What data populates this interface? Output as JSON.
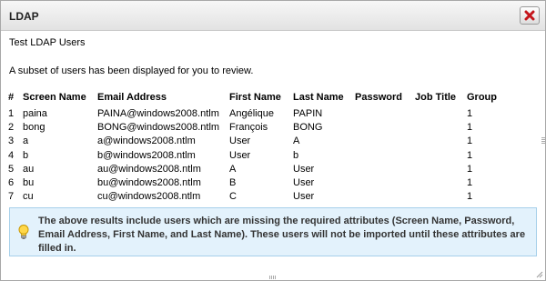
{
  "dialog": {
    "title": "LDAP",
    "close_icon": "close-icon",
    "close_color": "#c4161c"
  },
  "content": {
    "subtitle": "Test LDAP Users",
    "message": "A subset of users has been displayed for you to review."
  },
  "table": {
    "headers": [
      "#",
      "Screen Name",
      "Email Address",
      "First Name",
      "Last Name",
      "Password",
      "Job Title",
      "Group"
    ],
    "rows": [
      [
        "1",
        "paina",
        "PAINA@windows2008.ntlm",
        "Angélique",
        "PAPIN",
        "",
        "",
        "1"
      ],
      [
        "2",
        "bong",
        "BONG@windows2008.ntlm",
        "François",
        "BONG",
        "",
        "",
        "1"
      ],
      [
        "3",
        "a",
        "a@windows2008.ntlm",
        "User",
        "A",
        "",
        "",
        "1"
      ],
      [
        "4",
        "b",
        "b@windows2008.ntlm",
        "User",
        "b",
        "",
        "",
        "1"
      ],
      [
        "5",
        "au",
        "au@windows2008.ntlm",
        "A",
        "User",
        "",
        "",
        "1"
      ],
      [
        "6",
        "bu",
        "bu@windows2008.ntlm",
        "B",
        "User",
        "",
        "",
        "1"
      ],
      [
        "7",
        "cu",
        "cu@windows2008.ntlm",
        "C",
        "User",
        "",
        "",
        "1"
      ]
    ]
  },
  "notice": {
    "icon": "lightbulb-icon",
    "text": "The above results include users which are missing the required attributes (Screen Name, Password, Email Address, First Name, and Last Name). These users will not be imported until these attributes are filled in.",
    "background": "#e3f2fc",
    "border": "#a7d0ea"
  }
}
